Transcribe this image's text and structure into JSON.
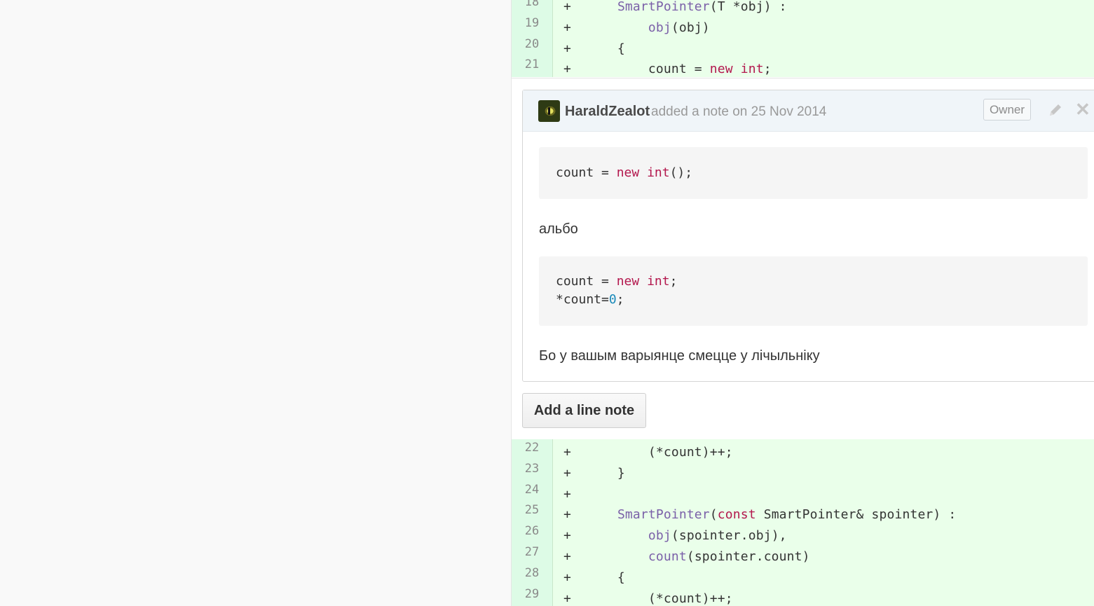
{
  "diff_top": [
    {
      "num": "18",
      "sign": "+",
      "segments": [
        [
          "",
          "    "
        ],
        [
          "fn",
          "SmartPointer"
        ],
        [
          "",
          "(T *obj) :"
        ]
      ]
    },
    {
      "num": "19",
      "sign": "+",
      "segments": [
        [
          "",
          "        "
        ],
        [
          "fn",
          "obj"
        ],
        [
          "",
          "(obj)"
        ]
      ]
    },
    {
      "num": "20",
      "sign": "+",
      "segments": [
        [
          "",
          "    {"
        ]
      ]
    },
    {
      "num": "21",
      "sign": "+",
      "segments": [
        [
          "",
          "        count = "
        ],
        [
          "kw",
          "new"
        ],
        [
          "",
          " "
        ],
        [
          "kw",
          "int"
        ],
        [
          "",
          ";"
        ]
      ]
    }
  ],
  "note": {
    "author": "HaraldZealot",
    "meta": "added a note on 25 Nov 2014",
    "owner_badge": "Owner",
    "code_block_1": [
      [
        [
          "",
          "count = "
        ],
        [
          "kw",
          "new"
        ],
        [
          "",
          " "
        ],
        [
          "kw",
          "int"
        ],
        [
          "",
          "();"
        ]
      ]
    ],
    "text_1": "альбо",
    "code_block_2": [
      [
        [
          "",
          "count = "
        ],
        [
          "kw",
          "new"
        ],
        [
          "",
          " "
        ],
        [
          "kw",
          "int"
        ],
        [
          "",
          ";"
        ]
      ],
      [
        [
          "",
          "*count="
        ],
        [
          "num",
          "0"
        ],
        [
          "",
          ";"
        ]
      ]
    ],
    "text_2": "Бо у вашым варыянце смецце у лічыльніку"
  },
  "add_note_label": "Add a line note",
  "diff_bottom": [
    {
      "num": "22",
      "sign": "+",
      "segments": [
        [
          "",
          "        (*count)++;"
        ]
      ]
    },
    {
      "num": "23",
      "sign": "+",
      "segments": [
        [
          "",
          "    }"
        ]
      ]
    },
    {
      "num": "24",
      "sign": "+",
      "segments": []
    },
    {
      "num": "25",
      "sign": "+",
      "segments": [
        [
          "",
          "    "
        ],
        [
          "fn",
          "SmartPointer"
        ],
        [
          "",
          "("
        ],
        [
          "kw",
          "const"
        ],
        [
          "",
          " SmartPointer& spointer) :"
        ]
      ]
    },
    {
      "num": "26",
      "sign": "+",
      "segments": [
        [
          "",
          "        "
        ],
        [
          "fn",
          "obj"
        ],
        [
          "",
          "(spointer.obj),"
        ]
      ]
    },
    {
      "num": "27",
      "sign": "+",
      "segments": [
        [
          "",
          "        "
        ],
        [
          "fn",
          "count"
        ],
        [
          "",
          "(spointer.count)"
        ]
      ]
    },
    {
      "num": "28",
      "sign": "+",
      "segments": [
        [
          "",
          "    {"
        ]
      ]
    },
    {
      "num": "29",
      "sign": "+",
      "segments": [
        [
          "",
          "        (*count)++;"
        ]
      ]
    }
  ],
  "colors": {
    "added_bg": "#eaffea",
    "keyword": "#b3174d",
    "function": "#7a5fa8",
    "number": "#1a8aba"
  },
  "icons": {
    "edit": "pencil-icon",
    "close": "close-icon"
  }
}
